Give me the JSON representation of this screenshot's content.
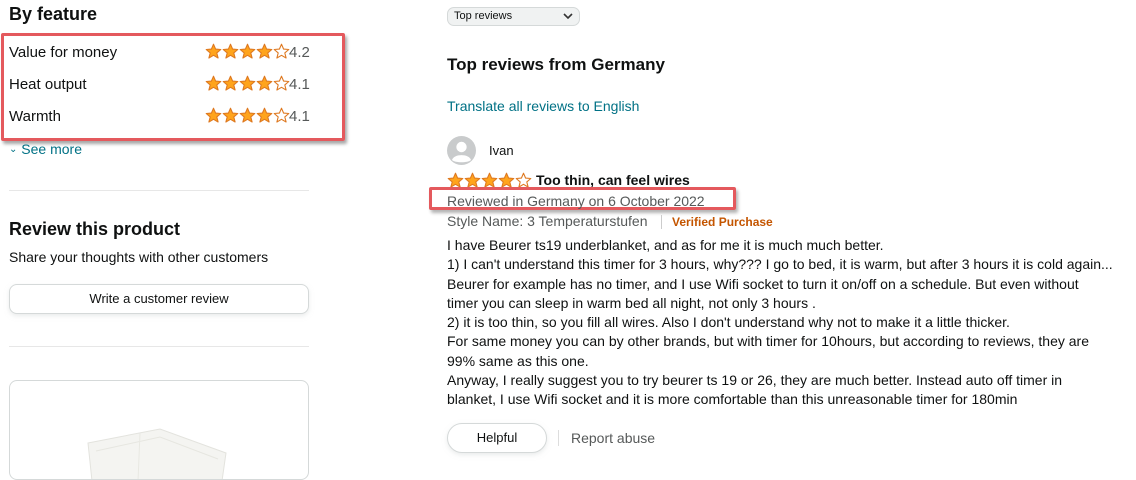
{
  "colors": {
    "star_fill": "#ffa41c",
    "star_stroke": "#de7921",
    "link": "#007185",
    "highlight_box": "#e4595d",
    "verified": "#c45500"
  },
  "features": {
    "title": "By feature",
    "items": [
      {
        "label": "Value for money",
        "rating": 4,
        "value": "4.2"
      },
      {
        "label": "Heat output",
        "rating": 4,
        "value": "4.1"
      },
      {
        "label": "Warmth",
        "rating": 4,
        "value": "4.1"
      }
    ],
    "see_more": "See more"
  },
  "review_product": {
    "title": "Review this product",
    "subtitle": "Share your thoughts with other customers",
    "button_label": "Write a customer review"
  },
  "sort": {
    "selected": "Top reviews",
    "icon": "chevron-down-icon"
  },
  "reviews_section": {
    "title": "Top reviews from Germany",
    "translate_link": "Translate all reviews to English"
  },
  "review": {
    "reviewer": "Ivan",
    "avatar_icon": "user-avatar-icon",
    "rating": 4,
    "title": "Too thin, can feel wires",
    "date": "Reviewed in Germany on 6 October 2022",
    "style_name": "Style Name: 3 Temperaturstufen",
    "verified": "Verified Purchase",
    "body_lines": [
      "I have Beurer ts19 underblanket, and as for me it is much much better.",
      "1) I can't understand this timer for 3 hours, why??? I go to bed, it is warm, but after 3 hours it is cold again...",
      "Beurer for example has no timer, and I use Wifi socket to turn it on/off on a schedule. But even without",
      "timer you can sleep in warm bed all night, not only 3 hours .",
      "2) it is too thin, so you fill all wires. Also I don't understand why not to make it a little thicker.",
      "For same money you can by other brands, but with timer for 10hours, but according to reviews, they are",
      "99% same as this one.",
      "Anyway, I really suggest you to try beurer ts 19 or 26, they are much better. Instead auto off timer in",
      "blanket, I use Wifi socket and it is more comfortable than this unreasonable timer for 180min"
    ],
    "helpful_label": "Helpful",
    "report_label": "Report abuse"
  }
}
